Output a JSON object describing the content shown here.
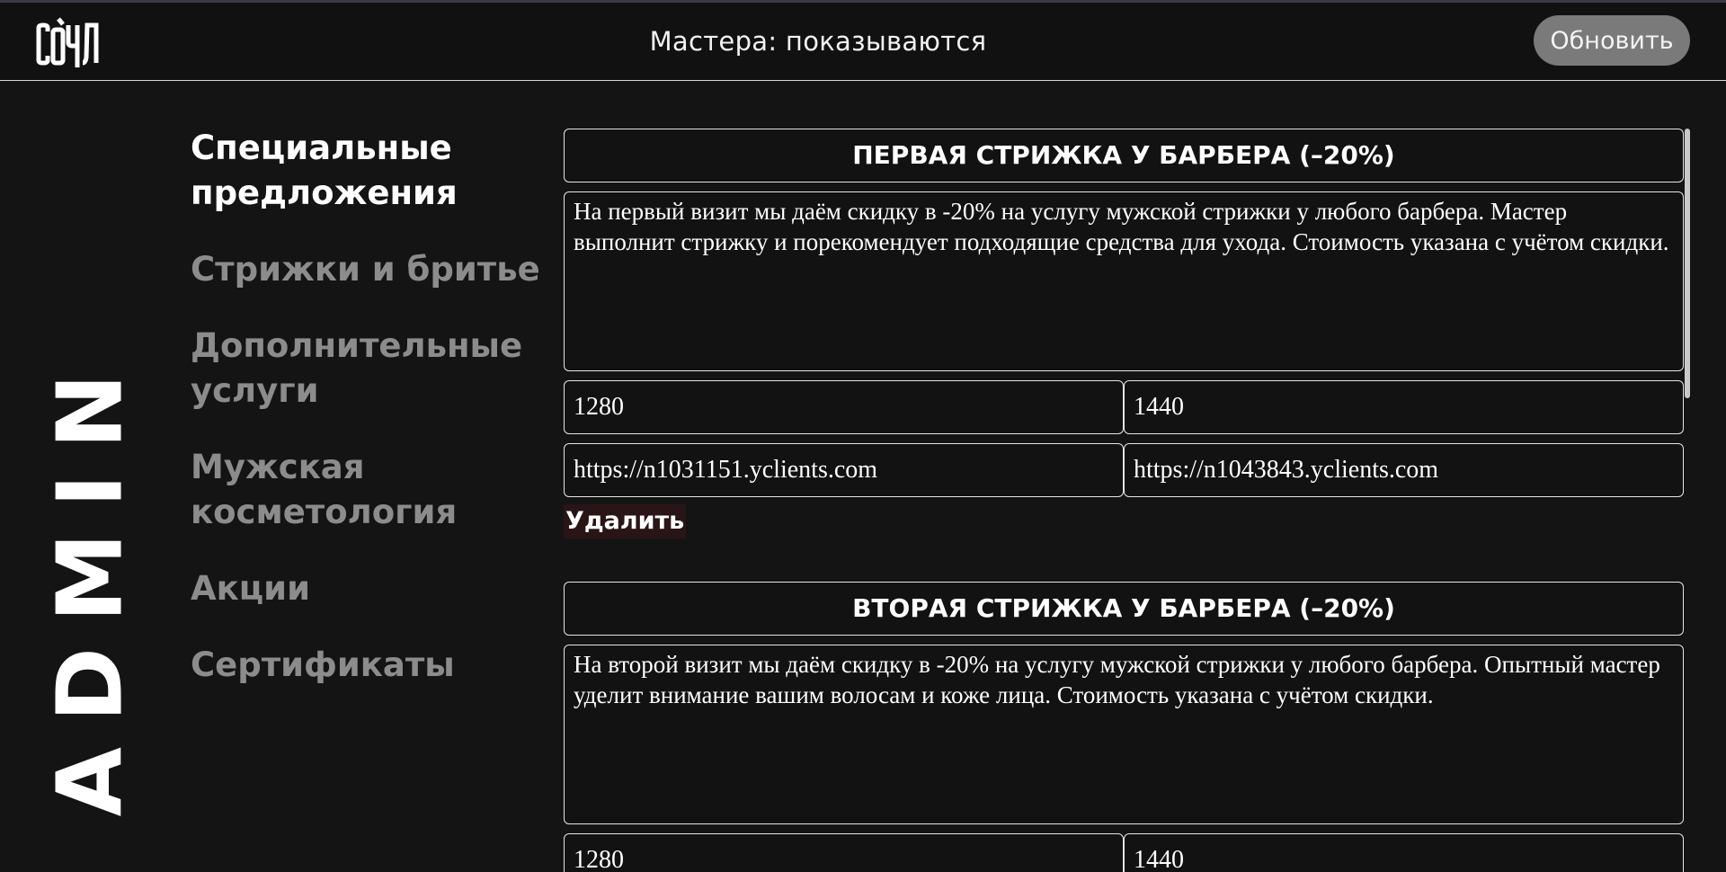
{
  "header": {
    "logo_text": "СОУЛ",
    "status_text": "Мастера: показываются",
    "refresh_label": "Обновить"
  },
  "side_title": "ADMIN",
  "nav": {
    "items": [
      {
        "label": "Специальные предложения",
        "active": true
      },
      {
        "label": "Стрижки и бритье",
        "active": false
      },
      {
        "label": "Дополнительные услуги",
        "active": false
      },
      {
        "label": "Мужская косметология",
        "active": false
      },
      {
        "label": "Акции",
        "active": false
      },
      {
        "label": "Сертификаты",
        "active": false
      }
    ]
  },
  "offers": [
    {
      "title": "ПЕРВАЯ СТРИЖКА У БАРБЕРА (–20%)",
      "description": "На первый визит мы даём скидку в -20% на услугу мужской стрижки у любого барбера. Мастер выполнит стрижку и порекомендует подходящие средства для ухода. Стоимость указана с учётом скидки.",
      "price_1": "1280",
      "price_2": "1440",
      "link_1": "https://n1031151.yclients.com",
      "link_2": "https://n1043843.yclients.com",
      "delete_label": "Удалить"
    },
    {
      "title": "ВТОРАЯ СТРИЖКА У БАРБЕРА (–20%)",
      "description": "На второй визит мы даём скидку в -20% на услугу мужской стрижки у любого барбера. Опытный мастер уделит внимание вашим волосам и коже лица. Стоимость указана с учётом скидки.",
      "price_1": "1280",
      "price_2": "1440"
    }
  ],
  "colors": {
    "background": "#141414",
    "header_bg": "#111111",
    "refresh_button_bg": "#7a7a7a",
    "nav_inactive": "#8c8c8c",
    "nav_active": "#ffffff",
    "delete_bg": "#2a1516"
  }
}
